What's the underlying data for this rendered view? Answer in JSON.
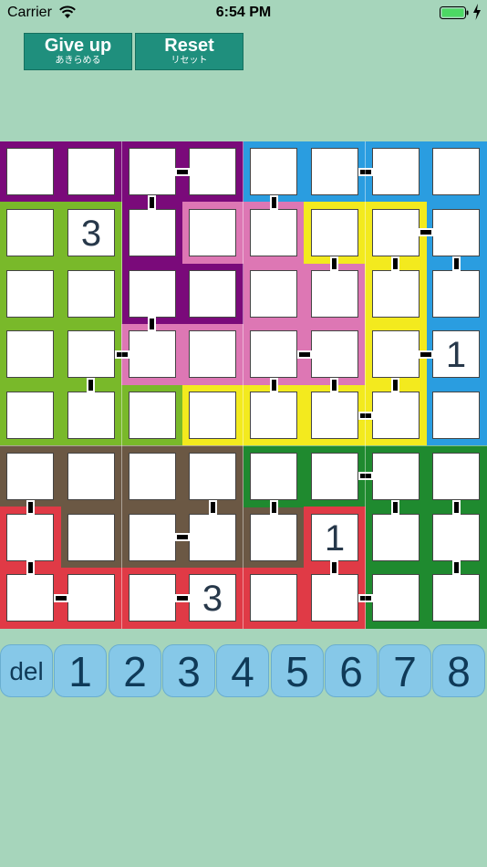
{
  "status_bar": {
    "carrier": "Carrier",
    "time": "6:54 PM"
  },
  "toolbar": {
    "give_up_label": "Give up",
    "give_up_sub": "あきらめる",
    "reset_label": "Reset",
    "reset_sub": "リセット"
  },
  "colors": {
    "background": "#a6d5bb",
    "purple": "#7a0a7a",
    "blue": "#2a9de0",
    "lime": "#79b92a",
    "pink": "#dd77b4",
    "yellow": "#f3ea1e",
    "brown": "#6b5844",
    "green": "#1f8a2f",
    "red": "#e03a46"
  },
  "board": {
    "rows": [
      [
        "",
        "",
        "",
        "",
        "",
        "",
        "",
        ""
      ],
      [
        "",
        "3",
        "",
        "",
        "",
        "",
        "",
        ""
      ],
      [
        "",
        "",
        "",
        "",
        "",
        "",
        "",
        ""
      ],
      [
        "",
        "",
        "",
        "",
        "",
        "",
        "",
        "1"
      ],
      [
        "",
        "",
        "",
        "",
        "",
        "",
        "",
        ""
      ],
      [
        "",
        "",
        "",
        "",
        "",
        "",
        "",
        ""
      ],
      [
        "",
        "",
        "",
        "",
        "",
        "1",
        "",
        ""
      ],
      [
        "",
        "",
        "",
        "3",
        "",
        "",
        "",
        ""
      ]
    ],
    "regions": [
      {
        "color": "purple",
        "cells": [
          [
            0,
            0
          ],
          [
            0,
            1
          ],
          [
            0,
            2
          ],
          [
            0,
            3
          ],
          [
            1,
            2
          ],
          [
            2,
            2
          ],
          [
            2,
            3
          ]
        ]
      },
      {
        "color": "blue",
        "cells": [
          [
            0,
            4
          ],
          [
            0,
            5
          ],
          [
            0,
            6
          ],
          [
            0,
            7
          ],
          [
            1,
            7
          ],
          [
            2,
            7
          ],
          [
            3,
            7
          ],
          [
            4,
            7
          ]
        ]
      },
      {
        "color": "lime",
        "cells": [
          [
            1,
            0
          ],
          [
            1,
            1
          ],
          [
            2,
            0
          ],
          [
            2,
            1
          ],
          [
            3,
            0
          ],
          [
            3,
            1
          ],
          [
            4,
            0
          ],
          [
            4,
            1
          ],
          [
            4,
            2
          ]
        ]
      },
      {
        "color": "pink",
        "cells": [
          [
            1,
            3
          ],
          [
            1,
            4
          ],
          [
            2,
            4
          ],
          [
            2,
            5
          ],
          [
            3,
            2
          ],
          [
            3,
            3
          ],
          [
            3,
            4
          ],
          [
            3,
            5
          ]
        ]
      },
      {
        "color": "yellow",
        "cells": [
          [
            1,
            5
          ],
          [
            1,
            6
          ],
          [
            2,
            6
          ],
          [
            3,
            6
          ],
          [
            4,
            3
          ],
          [
            4,
            4
          ],
          [
            4,
            5
          ],
          [
            4,
            6
          ]
        ]
      },
      {
        "color": "brown",
        "cells": [
          [
            5,
            0
          ],
          [
            5,
            1
          ],
          [
            5,
            2
          ],
          [
            5,
            3
          ],
          [
            6,
            1
          ],
          [
            6,
            2
          ],
          [
            6,
            3
          ],
          [
            6,
            4
          ]
        ]
      },
      {
        "color": "green",
        "cells": [
          [
            5,
            4
          ],
          [
            5,
            5
          ],
          [
            5,
            6
          ],
          [
            5,
            7
          ],
          [
            6,
            6
          ],
          [
            6,
            7
          ],
          [
            7,
            6
          ],
          [
            7,
            7
          ]
        ]
      },
      {
        "color": "red",
        "cells": [
          [
            6,
            0
          ],
          [
            6,
            5
          ],
          [
            7,
            0
          ],
          [
            7,
            1
          ],
          [
            7,
            2
          ],
          [
            7,
            3
          ],
          [
            7,
            4
          ],
          [
            7,
            5
          ]
        ]
      }
    ],
    "h_bars": [
      [
        0,
        2
      ],
      [
        0,
        5
      ],
      [
        1,
        6
      ],
      [
        3,
        1
      ],
      [
        3,
        4
      ],
      [
        3,
        6
      ],
      [
        4,
        5
      ],
      [
        5,
        5
      ],
      [
        6,
        2
      ],
      [
        7,
        0
      ],
      [
        7,
        2
      ],
      [
        7,
        5
      ]
    ],
    "v_bars": [
      [
        0,
        2
      ],
      [
        0,
        4
      ],
      [
        1,
        5
      ],
      [
        1,
        6
      ],
      [
        1,
        7
      ],
      [
        2,
        2
      ],
      [
        3,
        1
      ],
      [
        3,
        4
      ],
      [
        3,
        5
      ],
      [
        3,
        6
      ],
      [
        5,
        0
      ],
      [
        5,
        3
      ],
      [
        5,
        4
      ],
      [
        5,
        6
      ],
      [
        5,
        7
      ],
      [
        6,
        0
      ],
      [
        6,
        5
      ],
      [
        6,
        7
      ]
    ]
  },
  "keypad": [
    "del",
    "1",
    "2",
    "3",
    "4",
    "5",
    "6",
    "7",
    "8"
  ]
}
